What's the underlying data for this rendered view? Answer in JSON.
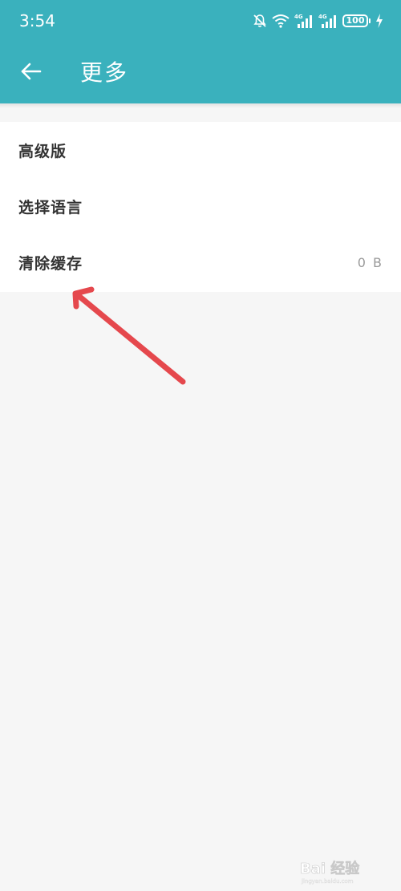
{
  "status_bar": {
    "time": "3:54",
    "battery": "100",
    "network_labels": [
      "4G",
      "4G"
    ],
    "icons": [
      "mute-bell-icon",
      "wifi-icon",
      "signal-icon",
      "signal-icon",
      "battery-icon",
      "charging-icon"
    ]
  },
  "toolbar": {
    "back_icon": "back-arrow-icon",
    "title": "更多"
  },
  "settings": {
    "items": [
      {
        "label": "高级版",
        "value": ""
      },
      {
        "label": "选择语言",
        "value": ""
      },
      {
        "label": "清除缓存",
        "value": "0 B"
      }
    ]
  },
  "colors": {
    "header": "#3ab1bd",
    "background": "#f6f6f6",
    "list_background": "#ffffff",
    "annotation_arrow": "#e5484d"
  },
  "watermark": {
    "text": "Bai 经验",
    "url_text": "jingyan.baidu.com"
  }
}
